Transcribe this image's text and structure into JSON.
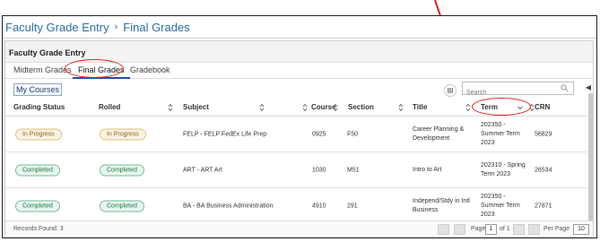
{
  "breadcrumb": {
    "parent": "Faculty Grade Entry",
    "current": "Final Grades"
  },
  "panel": {
    "title": "Faculty Grade Entry"
  },
  "tabs": [
    {
      "label": "Midterm Grades",
      "active": false
    },
    {
      "label": "Final Grades",
      "active": true
    },
    {
      "label": "Gradebook",
      "active": false
    }
  ],
  "toolbar": {
    "my_courses": "My Courses",
    "search_placeholder": "Search"
  },
  "columns": [
    "Grading Status",
    "Rolled",
    "Subject",
    "Course",
    "Section",
    "Title",
    "Term",
    "CRN"
  ],
  "rows": [
    {
      "status": "In Progress",
      "status_type": "in-progress",
      "rolled": "In Progress",
      "rolled_type": "in-progress",
      "subject": "FELP - FELP FedEx Life Prep",
      "course": "0925",
      "section": "F50",
      "title": "Career Planning & Development",
      "term": "202350 - Summer Term 2023",
      "crn": "56829"
    },
    {
      "status": "Completed",
      "status_type": "completed",
      "rolled": "Completed",
      "rolled_type": "completed",
      "subject": "ART - ART Art",
      "course": "1030",
      "section": "M51",
      "title": "Intro to Art",
      "term": "202310 - Spring Term 2023",
      "crn": "26534"
    },
    {
      "status": "Completed",
      "status_type": "completed",
      "rolled": "Completed",
      "rolled_type": "completed",
      "subject": "BA - BA Business Administration",
      "course": "4910",
      "section": "291",
      "title": "Independ/Stdy in Intl Business",
      "term": "202350 - Summer Term 2023",
      "crn": "27871"
    }
  ],
  "footer": {
    "records_label": "Records Found: 3",
    "page_label": "Page",
    "page_value": "1",
    "of_label": "of 1",
    "per_page_label": "Per Page",
    "per_page_value": "10"
  },
  "colors": {
    "link": "#2e6da4",
    "annotation": "#e02020",
    "active_tab": "#1f4fa6"
  }
}
